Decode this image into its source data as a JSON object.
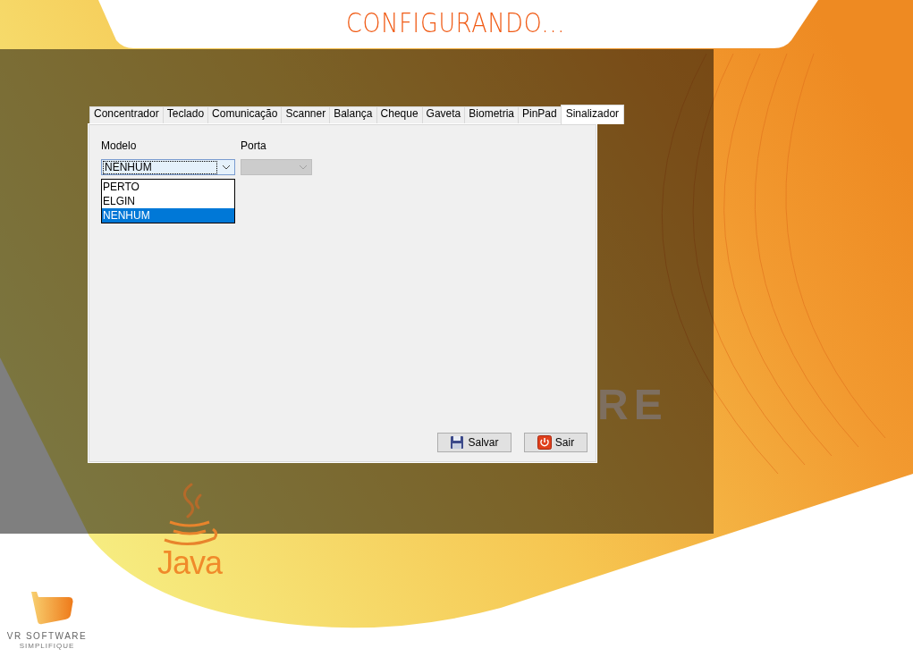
{
  "title": "CONFIGURANDO...",
  "tabs": [
    {
      "label": "Concentrador",
      "selected": false
    },
    {
      "label": "Teclado",
      "selected": false
    },
    {
      "label": "Comunicação",
      "selected": false
    },
    {
      "label": "Scanner",
      "selected": false
    },
    {
      "label": "Balança",
      "selected": false
    },
    {
      "label": "Cheque",
      "selected": false
    },
    {
      "label": "Gaveta",
      "selected": false
    },
    {
      "label": "Biometria",
      "selected": false
    },
    {
      "label": "PinPad",
      "selected": false
    },
    {
      "label": "Sinalizador",
      "selected": true
    }
  ],
  "fields": [
    {
      "label": "Modelo",
      "value": "NENHUM",
      "disabled": false,
      "expanded": true,
      "options": [
        {
          "label": "PERTO",
          "selected": false
        },
        {
          "label": "ELGIN",
          "selected": false
        },
        {
          "label": "NENHUM",
          "selected": true
        }
      ]
    },
    {
      "label": "Porta",
      "disabled": true
    }
  ],
  "buttons": [
    {
      "label": "Salvar",
      "kind": "save"
    },
    {
      "label": "Sair",
      "kind": "exit"
    }
  ],
  "background_text": "RE",
  "java_logo": "Java",
  "brand": {
    "name": "VR SOFTWARE",
    "tagline": "SIMPLIFIQUE"
  }
}
